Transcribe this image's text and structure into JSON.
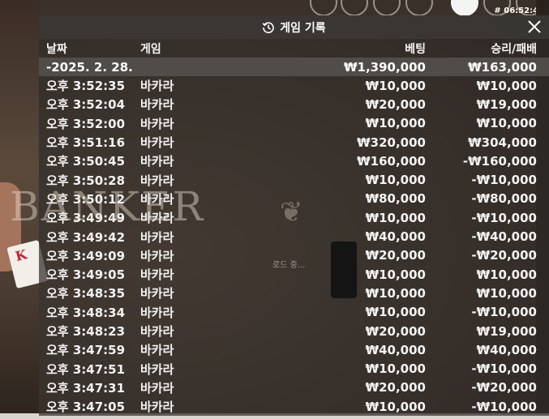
{
  "clock": "# 06:52:43",
  "panel": {
    "title": "게임 기록",
    "columns": {
      "date": "날짜",
      "game": "게임",
      "bet": "베팅",
      "result": "승리/패배"
    },
    "summary": {
      "date": "-2025. 2. 28.",
      "game": "",
      "bet": "₩1,390,000",
      "result": "₩163,000"
    },
    "rows": [
      {
        "time": "오후 3:52:35",
        "game": "바카라",
        "bet": "₩10,000",
        "result": "₩10,000"
      },
      {
        "time": "오후 3:52:04",
        "game": "바카라",
        "bet": "₩20,000",
        "result": "₩19,000"
      },
      {
        "time": "오후 3:52:00",
        "game": "바카라",
        "bet": "₩10,000",
        "result": "₩10,000"
      },
      {
        "time": "오후 3:51:16",
        "game": "바카라",
        "bet": "₩320,000",
        "result": "₩304,000"
      },
      {
        "time": "오후 3:50:45",
        "game": "바카라",
        "bet": "₩160,000",
        "result": "-₩160,000"
      },
      {
        "time": "오후 3:50:28",
        "game": "바카라",
        "bet": "₩10,000",
        "result": "-₩10,000"
      },
      {
        "time": "오후 3:50:12",
        "game": "바카라",
        "bet": "₩80,000",
        "result": "-₩80,000"
      },
      {
        "time": "오후 3:49:49",
        "game": "바카라",
        "bet": "₩10,000",
        "result": "-₩10,000"
      },
      {
        "time": "오후 3:49:42",
        "game": "바카라",
        "bet": "₩40,000",
        "result": "-₩40,000"
      },
      {
        "time": "오후 3:49:09",
        "game": "바카라",
        "bet": "₩20,000",
        "result": "-₩20,000"
      },
      {
        "time": "오후 3:49:05",
        "game": "바카라",
        "bet": "₩10,000",
        "result": "₩10,000"
      },
      {
        "time": "오후 3:48:35",
        "game": "바카라",
        "bet": "₩10,000",
        "result": "₩10,000"
      },
      {
        "time": "오후 3:48:34",
        "game": "바카라",
        "bet": "₩10,000",
        "result": "-₩10,000"
      },
      {
        "time": "오후 3:48:23",
        "game": "바카라",
        "bet": "₩20,000",
        "result": "₩19,000"
      },
      {
        "time": "오후 3:47:59",
        "game": "바카라",
        "bet": "₩40,000",
        "result": "₩40,000"
      },
      {
        "time": "오후 3:47:51",
        "game": "바카라",
        "bet": "₩10,000",
        "result": "-₩10,000"
      },
      {
        "time": "오후 3:47:31",
        "game": "바카라",
        "bet": "₩20,000",
        "result": "-₩20,000"
      },
      {
        "time": "오후 3:47:05",
        "game": "바카라",
        "bet": "₩10,000",
        "result": "-₩10,000"
      }
    ]
  },
  "background": {
    "table_text": "BANKER",
    "loading_text": "로드 중...",
    "card_text": "K"
  },
  "icons": {
    "title": "history-icon",
    "close": "close-icon"
  }
}
